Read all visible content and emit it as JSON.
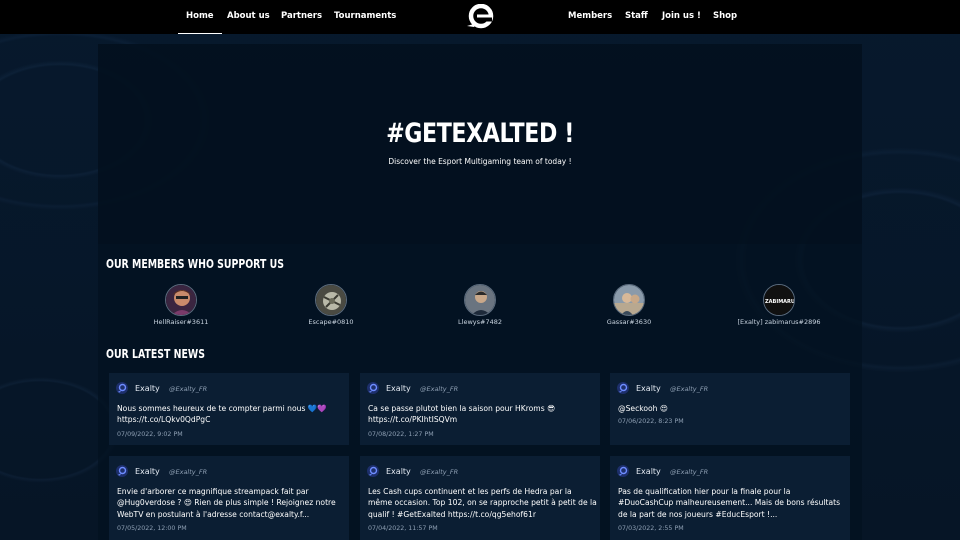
{
  "nav": {
    "left": [
      {
        "label": "Home",
        "active": true
      },
      {
        "label": "About us"
      },
      {
        "label": "Partners"
      },
      {
        "label": "Tournaments"
      }
    ],
    "right": [
      {
        "label": "Members"
      },
      {
        "label": "Staff"
      },
      {
        "label": "Join us !"
      },
      {
        "label": "Shop"
      }
    ],
    "logo_icon": "exalty-logo-icon"
  },
  "hero": {
    "title": "#GETEXALTED !",
    "subtitle": "Discover the Esport Multigaming team of today !"
  },
  "members_section": {
    "title": "OUR MEMBERS WHO SUPPORT US",
    "members": [
      {
        "name": "HellRaiser#3611",
        "color": "#6b3a5a"
      },
      {
        "name": "Escape#0810",
        "color": "#8a8a7a"
      },
      {
        "name": "Llewys#7482",
        "color": "#4a5a6a"
      },
      {
        "name": "Gassar#3630",
        "color": "#7a8a9a"
      },
      {
        "name": "[Exalty] zabimarus#2896",
        "avatar_text": "ZABIMARU",
        "color": "#1a1a1a"
      }
    ]
  },
  "news_section": {
    "title": "OUR LATEST NEWS",
    "cards": [
      {
        "user": "Exalty",
        "handle": "@Exalty_FR",
        "text": "Nous sommes heureux de te compter parmi nous 💙💜 https://t.co/LQkv0QdPgC",
        "date": "07/09/2022, 9:02 PM"
      },
      {
        "user": "Exalty",
        "handle": "@Exalty_FR",
        "text": "Ca se passe plutot bien la saison pour HKroms 😎 https://t.co/PKIhtISQVm",
        "date": "07/08/2022, 1:27 PM"
      },
      {
        "user": "Exalty",
        "handle": "@Exalty_FR",
        "text": "@Seckooh 😍",
        "date": "07/06/2022, 8:23 PM"
      },
      {
        "user": "Exalty",
        "handle": "@Exalty_FR",
        "text": "Envie d'arborer ce magnifique streampack fait par @Hug0verdose ? 😍 Rien de plus simple ! Rejoignez notre WebTV en postulant à l'adresse contact@exalty.f...",
        "date": "07/05/2022, 12:00 PM"
      },
      {
        "user": "Exalty",
        "handle": "@Exalty_FR",
        "text": "Les Cash cups continuent et les perfs de Hedra par la même occasion. Top 102, on se rapproche petit à petit de la qualif ! #GetExalted https://t.co/qg5ehof61r",
        "date": "07/04/2022, 11:57 PM"
      },
      {
        "user": "Exalty",
        "handle": "@Exalty_FR",
        "text": "Pas de qualification hier pour la finale pour la #DuoCashCup malheureusement... Mais de bons résultats de la part de nos joueurs #EducEsport !...",
        "date": "07/03/2022, 2:55 PM"
      }
    ]
  },
  "colors": {
    "background": "#061729",
    "nav": "#000000",
    "card": "#0b1e33",
    "accent_icon": "#3b5bdb"
  }
}
